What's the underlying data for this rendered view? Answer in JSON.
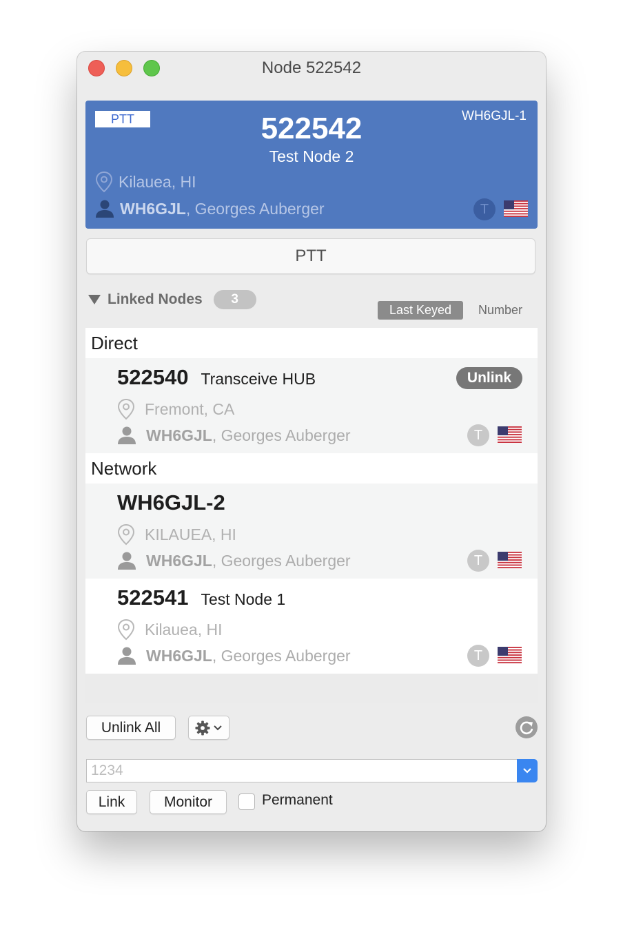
{
  "window": {
    "title": "Node 522542"
  },
  "header": {
    "ptt_badge": "PTT",
    "callsign": "WH6GJL-1",
    "node_number": "522542",
    "node_name": "Test Node 2",
    "location": "Kilauea, HI",
    "owner_call": "WH6GJL",
    "owner_name": ", Georges Auberger",
    "type_badge": "T",
    "flag_icon": "us-flag-icon"
  },
  "ptt_button": {
    "label": "PTT"
  },
  "linked": {
    "label": "Linked Nodes",
    "count": "3",
    "sort_options": [
      "Last Keyed",
      "Number"
    ],
    "sort_selected": "Last Keyed"
  },
  "sections": {
    "direct": "Direct",
    "network": "Network"
  },
  "nodes": [
    {
      "number": "522540",
      "name": "Transceive HUB",
      "location": "Fremont, CA",
      "owner_call": "WH6GJL",
      "owner_name": ", Georges Auberger",
      "type_badge": "T",
      "action": "Unlink"
    },
    {
      "number": "WH6GJL-2",
      "name": "",
      "location": "KILAUEA, HI",
      "owner_call": "WH6GJL",
      "owner_name": ", Georges Auberger",
      "type_badge": "T"
    },
    {
      "number": "522541",
      "name": "Test Node 1",
      "location": "Kilauea, HI",
      "owner_call": "WH6GJL",
      "owner_name": ", Georges Auberger",
      "type_badge": "T"
    }
  ],
  "toolbar": {
    "unlink_all": "Unlink All",
    "gear_icon": "gear-icon",
    "refresh_icon": "refresh-icon"
  },
  "link_form": {
    "input_value": "",
    "input_placeholder": "1234",
    "link_label": "Link",
    "monitor_label": "Monitor",
    "permanent_label": "Permanent",
    "permanent_checked": false
  },
  "colors": {
    "header_bg": "#5079bf",
    "accent": "#3a86f0",
    "close": "#ee5f57",
    "minimize": "#f6be3c",
    "maximize": "#5fc64c"
  }
}
